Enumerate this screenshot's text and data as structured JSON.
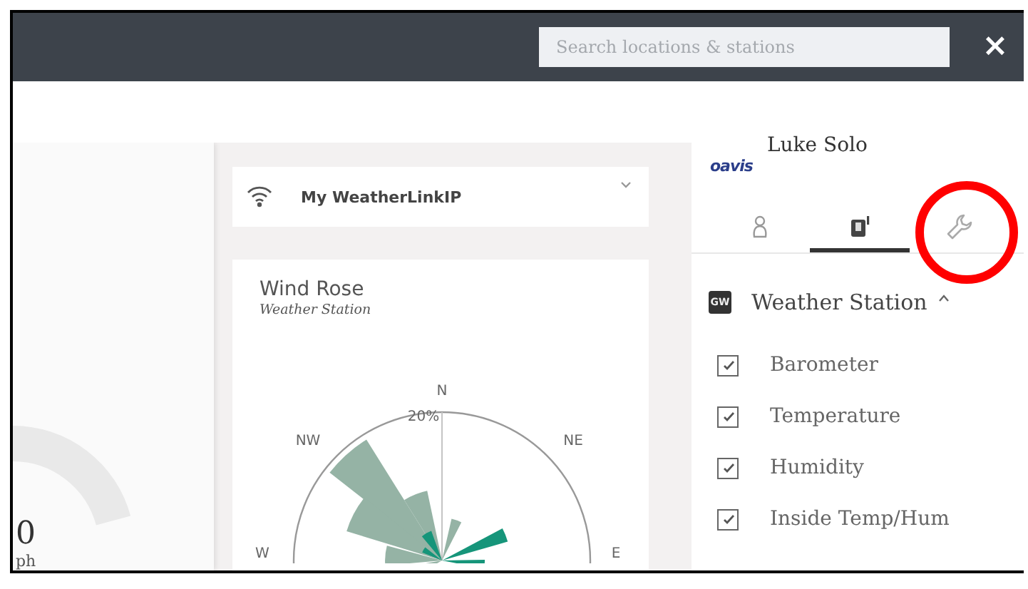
{
  "top_bar": {
    "search": {
      "placeholder": "Search locations & stations"
    },
    "close": "×"
  },
  "gauge": {
    "value": "0",
    "unit": "ph"
  },
  "station_select": {
    "value": "My WeatherLinkIP"
  },
  "wind_rose": {
    "title": "Wind Rose",
    "subtitle": "Weather Station",
    "ring_label": "20%",
    "compass_labels": {
      "n": "N",
      "ne": "NE",
      "e": "E",
      "w": "W",
      "nw": "NW"
    }
  },
  "profile": {
    "logo": "oavis",
    "name": "Luke Solo"
  },
  "tabs": [
    {
      "kind": "person",
      "selected": false,
      "highlighted": false
    },
    {
      "kind": "station",
      "selected": true,
      "highlighted": false
    },
    {
      "kind": "wrench",
      "selected": false,
      "highlighted": true
    }
  ],
  "section": {
    "badge": "GW",
    "title": "Weather Station",
    "expanded": true,
    "items": [
      {
        "label": "Barometer",
        "checked": true
      },
      {
        "label": "Temperature",
        "checked": true
      },
      {
        "label": "Humidity",
        "checked": true
      },
      {
        "label": "Inside Temp/Hum",
        "checked": true
      }
    ]
  }
}
